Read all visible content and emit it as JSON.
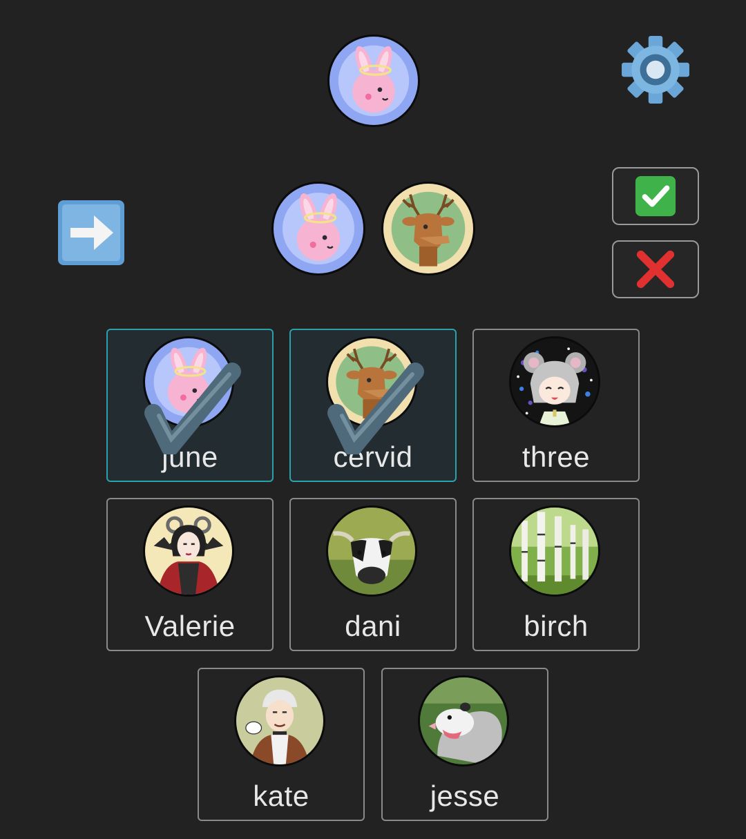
{
  "top": {
    "current_avatar": "bunny-halo-avatar",
    "settings_icon": "gear-icon"
  },
  "selection": {
    "arrow_icon": "right-arrow-icon",
    "selected_avatars": [
      "bunny-halo-avatar",
      "deer-avatar"
    ],
    "confirm_icon": "check-mark-icon",
    "cancel_icon": "cross-mark-icon"
  },
  "members": [
    {
      "name": "june",
      "avatar": "bunny-halo-avatar",
      "selected": true
    },
    {
      "name": "cervid",
      "avatar": "deer-avatar",
      "selected": true
    },
    {
      "name": "three",
      "avatar": "grey-hair-girl-avatar",
      "selected": false
    },
    {
      "name": "Valerie",
      "avatar": "horned-woman-avatar",
      "selected": false
    },
    {
      "name": "dani",
      "avatar": "cow-avatar",
      "selected": false
    },
    {
      "name": "birch",
      "avatar": "birch-trees-avatar",
      "selected": false
    },
    {
      "name": "kate",
      "avatar": "white-haired-man-avatar",
      "selected": false
    },
    {
      "name": "jesse",
      "avatar": "opossum-avatar",
      "selected": false
    }
  ],
  "colors": {
    "background": "#222222",
    "selected_border": "#2aa2aa",
    "card_border": "#8a8a8a",
    "confirm_green": "#3fb34a",
    "cancel_red": "#e03030",
    "arrow_blue": "#5e9ed4"
  }
}
